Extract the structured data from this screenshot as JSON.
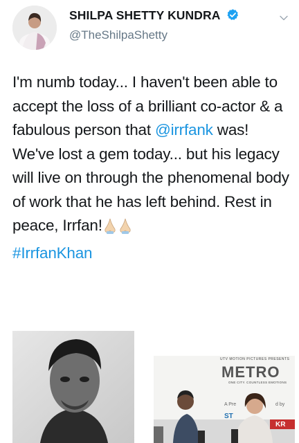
{
  "author": {
    "display_name": "SHILPA SHETTY KUNDRA",
    "handle": "@TheShilpaShetty",
    "verified": true
  },
  "tweet": {
    "text_part1": "I'm numb today... I haven't been able to accept the loss of a brilliant co-actor & a fabulous person that ",
    "mention": "@irrfank",
    "text_part2": " was! We've lost a gem today... but his legacy will live on through the phenomenal body of work that he has left behind. Rest in peace, Irrfan!",
    "hashtag": "#IrrfanKhan"
  },
  "media": {
    "right_poster": {
      "top_line": "UTV MOTION PICTURES PRESENTS",
      "title": "METRO",
      "tagline": "ONE CITY. COUNTLESS EMOTIONS",
      "partial_text": "A Pre",
      "partial_text2": "d by",
      "logo_partial": "ST",
      "logo_partial2": "KR"
    }
  },
  "colors": {
    "link": "#1b95e0",
    "verified": "#1da1f2",
    "secondary_text": "#657786"
  },
  "icons": {
    "verified": "verified-badge-icon",
    "menu": "chevron-down-icon",
    "emoji": "folded-hands-emoji"
  }
}
